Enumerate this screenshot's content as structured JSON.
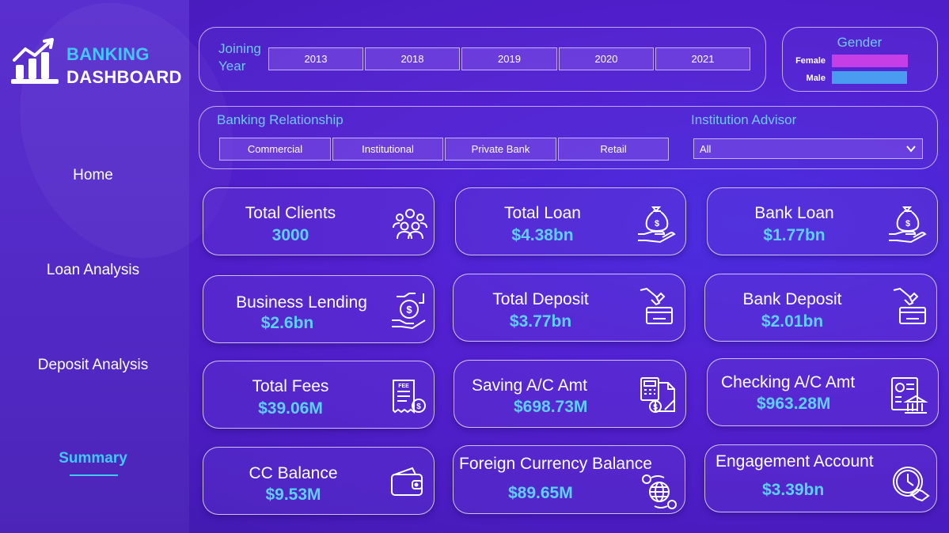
{
  "brand": {
    "line1": "BANKING",
    "line2": "DASHBOARD"
  },
  "nav": [
    {
      "label": "Home",
      "active": false
    },
    {
      "label": "Loan Analysis",
      "active": false
    },
    {
      "label": "Deposit Analysis",
      "active": false
    },
    {
      "label": "Summary",
      "active": true
    }
  ],
  "filters": {
    "joining_year": {
      "label_line1": "Joining",
      "label_line2": "Year",
      "options": [
        "2013",
        "2018",
        "2019",
        "2020",
        "2021"
      ]
    },
    "banking_relationship": {
      "label": "Banking Relationship",
      "options": [
        "Commercial",
        "Institutional",
        "Private Bank",
        "Retail"
      ]
    },
    "institution_advisor": {
      "label": "Institution Advisor",
      "selected": "All"
    }
  },
  "gender_legend": {
    "title": "Gender",
    "items": [
      {
        "label": "Female",
        "color": "#c53ee6"
      },
      {
        "label": "Male",
        "color": "#4a9cf0"
      }
    ]
  },
  "cards": [
    {
      "title": "Total Clients",
      "value": "3000",
      "icon": "people-group-icon"
    },
    {
      "title": "Total Loan",
      "value": "$4.38bn",
      "icon": "money-bag-hand-icon"
    },
    {
      "title": "Bank Loan",
      "value": "$1.77bn",
      "icon": "money-bag-hand-icon"
    },
    {
      "title": "Business Lending",
      "value": "$2.6bn",
      "icon": "coin-hand-icon"
    },
    {
      "title": "Total Deposit",
      "value": "$3.77bn",
      "icon": "deposit-icon"
    },
    {
      "title": "Bank Deposit",
      "value": "$2.01bn",
      "icon": "deposit-icon"
    },
    {
      "title": "Total Fees",
      "value": "$39.06M",
      "icon": "fee-receipt-icon"
    },
    {
      "title": "Saving A/C Amt",
      "value": "$698.73M",
      "icon": "calculator-document-icon"
    },
    {
      "title": "Checking A/C Amt",
      "value": "$963.28M",
      "icon": "bank-document-icon"
    },
    {
      "title": "CC Balance",
      "value": "$9.53M",
      "icon": "wallet-icon"
    },
    {
      "title": "Foreign Currency Balance",
      "value": "$89.65M",
      "icon": "globe-currency-icon"
    },
    {
      "title": "Engagement Account",
      "value": "$3.39bn",
      "icon": "clock-handshake-icon"
    }
  ],
  "colors": {
    "accent": "#40c8ff",
    "value_text": "#5cd0ff",
    "filter_label": "#6ec8ff"
  }
}
